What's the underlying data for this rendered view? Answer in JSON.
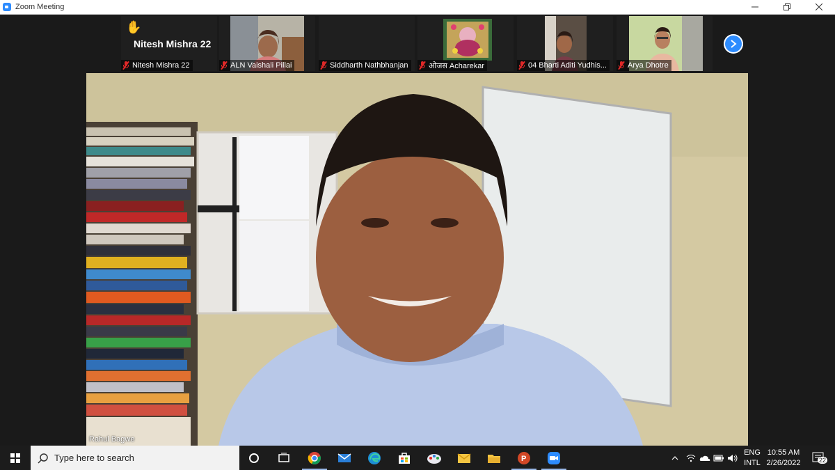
{
  "window": {
    "title": "Zoom Meeting"
  },
  "filmstrip": {
    "highlight_name": "Nitesh Mishra 22",
    "tiles": [
      {
        "name": "Nitesh Mishra 22"
      },
      {
        "name": "ALN Vaishali Pillai"
      },
      {
        "name": "Siddharth Nathbhanjan"
      },
      {
        "name": "ओजस Acharekar"
      },
      {
        "name": "04 Bharti Aditi Yudhis..."
      },
      {
        "name": "Arya Dhotre"
      }
    ]
  },
  "speaker": {
    "name": "Rahul Bagwe"
  },
  "taskbar": {
    "search_placeholder": "Type here to search",
    "lang_top": "ENG",
    "lang_bottom": "INTL",
    "time": "10:55 AM",
    "date": "2/26/2022",
    "notifications": "22"
  },
  "colors": {
    "accent": "#2d8cff",
    "muted_mic": "#e02828"
  }
}
